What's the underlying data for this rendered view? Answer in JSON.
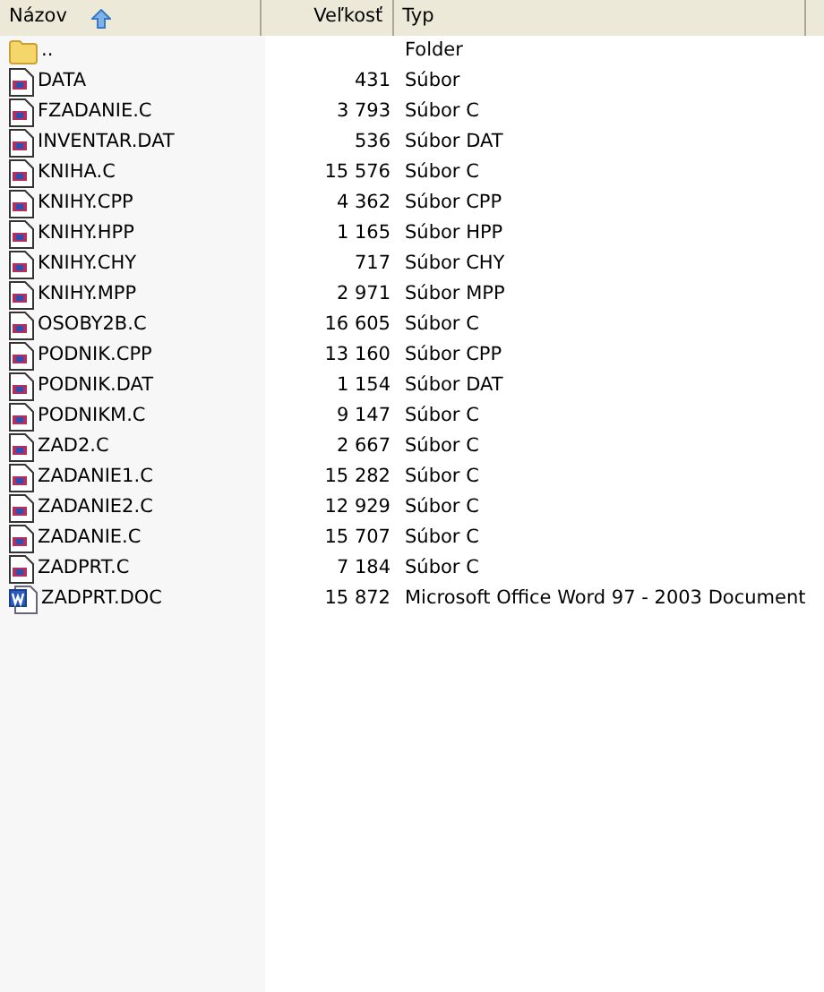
{
  "columns": [
    {
      "label": "Názov",
      "sorted": true
    },
    {
      "label": "Veľkosť",
      "sorted": false
    },
    {
      "label": "Typ",
      "sorted": false
    }
  ],
  "rows": [
    {
      "kind": "folder",
      "name": "..",
      "size": "",
      "type": "Folder"
    },
    {
      "kind": "file",
      "name": "DATA",
      "size": "431",
      "type": "Súbor"
    },
    {
      "kind": "file",
      "name": "FZADANIE.C",
      "size": "3 793",
      "type": "Súbor C"
    },
    {
      "kind": "file",
      "name": "INVENTAR.DAT",
      "size": "536",
      "type": "Súbor DAT"
    },
    {
      "kind": "file",
      "name": "KNIHA.C",
      "size": "15 576",
      "type": "Súbor C"
    },
    {
      "kind": "file",
      "name": "KNIHY.CPP",
      "size": "4 362",
      "type": "Súbor CPP"
    },
    {
      "kind": "file",
      "name": "KNIHY.HPP",
      "size": "1 165",
      "type": "Súbor HPP"
    },
    {
      "kind": "file",
      "name": "KNIHY.CHY",
      "size": "717",
      "type": "Súbor CHY"
    },
    {
      "kind": "file",
      "name": "KNIHY.MPP",
      "size": "2 971",
      "type": "Súbor MPP"
    },
    {
      "kind": "file",
      "name": "OSOBY2B.C",
      "size": "16 605",
      "type": "Súbor C"
    },
    {
      "kind": "file",
      "name": "PODNIK.CPP",
      "size": "13 160",
      "type": "Súbor CPP"
    },
    {
      "kind": "file",
      "name": "PODNIK.DAT",
      "size": "1 154",
      "type": "Súbor DAT"
    },
    {
      "kind": "file",
      "name": "PODNIKM.C",
      "size": "9 147",
      "type": "Súbor C"
    },
    {
      "kind": "file",
      "name": "ZAD2.C",
      "size": "2 667",
      "type": "Súbor C"
    },
    {
      "kind": "file",
      "name": "ZADANIE1.C",
      "size": "15 282",
      "type": "Súbor C"
    },
    {
      "kind": "file",
      "name": "ZADANIE2.C",
      "size": "12 929",
      "type": "Súbor C"
    },
    {
      "kind": "file",
      "name": "ZADANIE.C",
      "size": "15 707",
      "type": "Súbor C"
    },
    {
      "kind": "file",
      "name": "ZADPRT.C",
      "size": "7 184",
      "type": "Súbor C"
    },
    {
      "kind": "word",
      "name": "ZADPRT.DOC",
      "size": "15 872",
      "type": "Microsoft Office Word 97 - 2003 Document"
    }
  ]
}
